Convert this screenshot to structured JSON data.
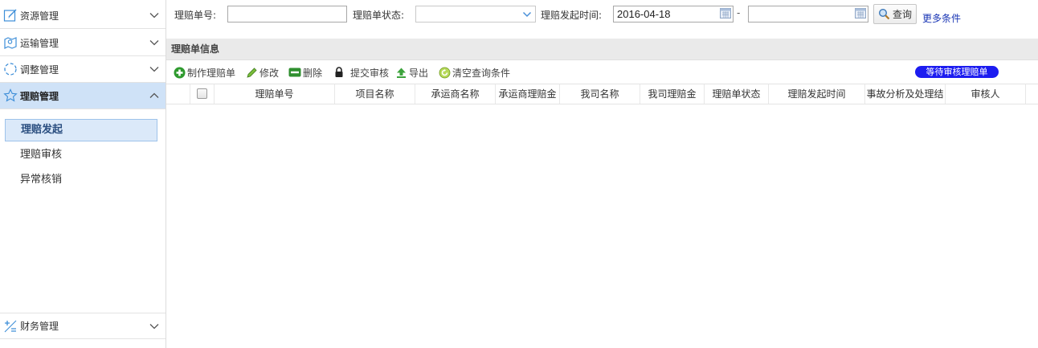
{
  "sidebar": {
    "items": [
      {
        "label": "资源管理",
        "icon": "edit-icon",
        "expanded": false
      },
      {
        "label": "运输管理",
        "icon": "map-icon",
        "expanded": false
      },
      {
        "label": "调整管理",
        "icon": "loop-icon",
        "expanded": false
      },
      {
        "label": "理赔管理",
        "icon": "star-icon",
        "expanded": true
      },
      {
        "label": "财务管理",
        "icon": "calculator-icon",
        "expanded": false
      }
    ],
    "subitems": [
      {
        "label": "理赔发起",
        "active": true
      },
      {
        "label": "理赔审核",
        "active": false
      },
      {
        "label": "异常核销",
        "active": false
      }
    ]
  },
  "filters": {
    "claim_no_label": "理赔单号:",
    "claim_no_value": "",
    "status_label": "理赔单状态:",
    "status_value": "",
    "time_label": "理赔发起时间:",
    "date_from": "2016-04-18",
    "date_separator": "-",
    "date_to": "",
    "query_label": "查询",
    "more_label": "更多条件"
  },
  "panel": {
    "title": "理赔单信息"
  },
  "toolbar": {
    "create": "制作理赔单",
    "edit": "修改",
    "delete": "删除",
    "submit": "提交审核",
    "export": "导出",
    "clear": "清空查询条件",
    "pending": "等待审核理赔单"
  },
  "grid": {
    "columns": [
      "理赔单号",
      "项目名称",
      "承运商名称",
      "承运商理赔金",
      "我司名称",
      "我司理赔金",
      "理赔单状态",
      "理赔发起时间",
      "事故分析及处理结",
      "审核人"
    ],
    "rows": []
  },
  "colors": {
    "active_menu_bg": "#cfe2f7",
    "pending_badge": "#1c1cf0",
    "link": "#1a36b5"
  }
}
